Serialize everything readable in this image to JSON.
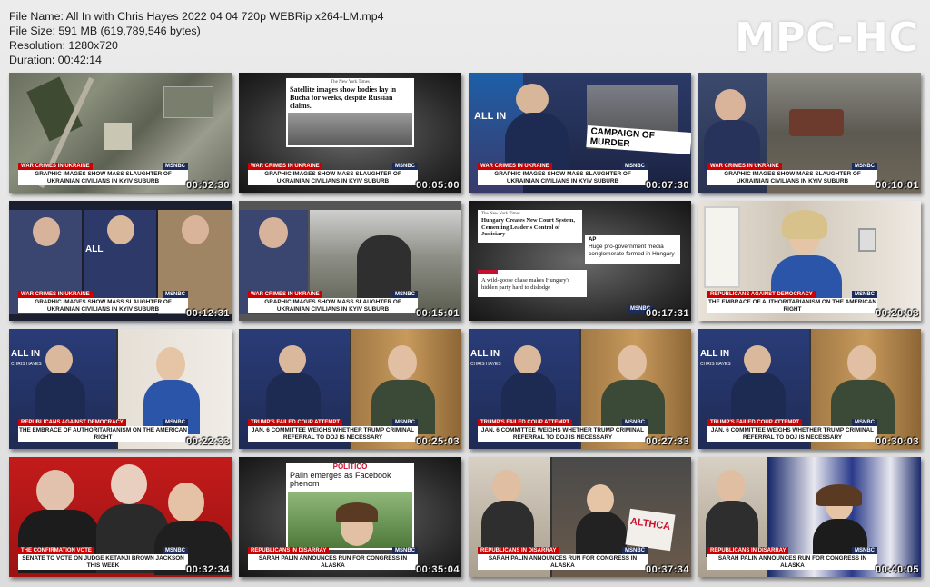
{
  "file_info": {
    "file_name": "File Name: All In with Chris Hayes 2022 04 04 720p WEBRip x264-LM.mp4",
    "file_size": "File Size: 591 MB (619,789,546 bytes)",
    "resolution": "Resolution: 1280x720",
    "duration": "Duration: 00:42:14"
  },
  "logo": "MPC-HC",
  "thumbnails": [
    {
      "tag": "WAR CRIMES IN UKRAINE",
      "network": "MSNBC",
      "headline": "GRAPHIC IMAGES SHOW MASS SLAUGHTER OF UKRAINIAN CIVILIANS IN KYIV SUBURB",
      "timestamp": "00:02:30"
    },
    {
      "tag": "WAR CRIMES IN UKRAINE",
      "network": "MSNBC",
      "headline": "GRAPHIC IMAGES SHOW MASS SLAUGHTER OF UKRAINIAN CIVILIANS IN KYIV SUBURB",
      "timestamp": "00:05:00",
      "card_source": "The New York Times",
      "card_text": "Satellite images show bodies lay in Bucha for weeks, despite Russian claims."
    },
    {
      "tag": "WAR CRIMES IN UKRAINE",
      "network": "MSNBC",
      "headline": "GRAPHIC IMAGES SHOW MASS SLAUGHTER OF UKRAINIAN CIVILIANS IN KYIV SUBURB",
      "timestamp": "00:07:30",
      "banner": "CAMPAIGN OF MURDER",
      "show_logo": "ALL IN"
    },
    {
      "tag": "WAR CRIMES IN UKRAINE",
      "network": "MSNBC",
      "headline": "GRAPHIC IMAGES SHOW MASS SLAUGHTER OF UKRAINIAN CIVILIANS IN KYIV SUBURB",
      "timestamp": "00:10:01"
    },
    {
      "tag": "WAR CRIMES IN UKRAINE",
      "network": "MSNBC",
      "headline": "GRAPHIC IMAGES SHOW MASS SLAUGHTER OF UKRAINIAN CIVILIANS IN KYIV SUBURB",
      "timestamp": "00:12:31",
      "show_logo": "ALL"
    },
    {
      "tag": "WAR CRIMES IN UKRAINE",
      "network": "MSNBC",
      "headline": "GRAPHIC IMAGES SHOW MASS SLAUGHTER OF UKRAINIAN CIVILIANS IN KYIV SUBURB",
      "timestamp": "00:15:01"
    },
    {
      "network": "MSNBC",
      "timestamp": "00:17:31",
      "card1_source": "The New York Times",
      "card1_text": "Hungary Creates New Court System, Cementing Leader's Control of Judiciary",
      "card2_source": "AP",
      "card2_text": "Huge pro-government media conglomerate formed in Hungary",
      "card3_text": "A wild-goose chase makes Hungary's hidden party hard to dislodge"
    },
    {
      "tag": "REPUBLICANS AGAINST DEMOCRACY",
      "network": "MSNBC",
      "headline": "THE EMBRACE OF AUTHORITARIANISM ON THE AMERICAN RIGHT",
      "timestamp": "00:20:03"
    },
    {
      "tag": "REPUBLICANS AGAINST DEMOCRACY",
      "network": "MSNBC",
      "headline": "THE EMBRACE OF AUTHORITARIANISM ON THE AMERICAN RIGHT",
      "timestamp": "00:22:33",
      "show_logo": "ALL IN",
      "host_name": "CHRIS HAYES"
    },
    {
      "tag": "TRUMP'S FAILED COUP ATTEMPT",
      "network": "MSNBC",
      "headline": "JAN. 6 COMMITTEE WEIGHS WHETHER TRUMP CRIMINAL REFERRAL TO DOJ IS NECESSARY",
      "timestamp": "00:25:03"
    },
    {
      "tag": "TRUMP'S FAILED COUP ATTEMPT",
      "network": "MSNBC",
      "headline": "JAN. 6 COMMITTEE WEIGHS WHETHER TRUMP CRIMINAL REFERRAL TO DOJ IS NECESSARY",
      "timestamp": "00:27:33",
      "show_logo": "ALL IN",
      "host_name": "CHRIS HAYES"
    },
    {
      "tag": "TRUMP'S FAILED COUP ATTEMPT",
      "network": "MSNBC",
      "headline": "JAN. 6 COMMITTEE WEIGHS WHETHER TRUMP CRIMINAL REFERRAL TO DOJ IS NECESSARY",
      "timestamp": "00:30:03",
      "show_logo": "ALL IN",
      "host_name": "CHRIS HAYES"
    },
    {
      "tag": "THE CONFIRMATION VOTE",
      "network": "MSNBC",
      "headline": "SENATE TO VOTE ON JUDGE KETANJI BROWN JACKSON THIS WEEK",
      "timestamp": "00:32:34"
    },
    {
      "tag": "REPUBLICANS IN DISARRAY",
      "network": "MSNBC",
      "headline": "SARAH PALIN ANNOUNCES RUN FOR CONGRESS IN ALASKA",
      "timestamp": "00:35:04",
      "card_source": "POLITICO",
      "card_text": "Palin emerges as Facebook phenom"
    },
    {
      "tag": "REPUBLICANS IN DISARRAY",
      "network": "MSNBC",
      "headline": "SARAH PALIN ANNOUNCES RUN FOR CONGRESS IN ALASKA",
      "timestamp": "00:37:34",
      "sign_text": "ALTHCA"
    },
    {
      "tag": "REPUBLICANS IN DISARRAY",
      "network": "MSNBC",
      "headline": "SARAH PALIN ANNOUNCES RUN FOR CONGRESS IN ALASKA",
      "timestamp": "00:40:05"
    }
  ]
}
